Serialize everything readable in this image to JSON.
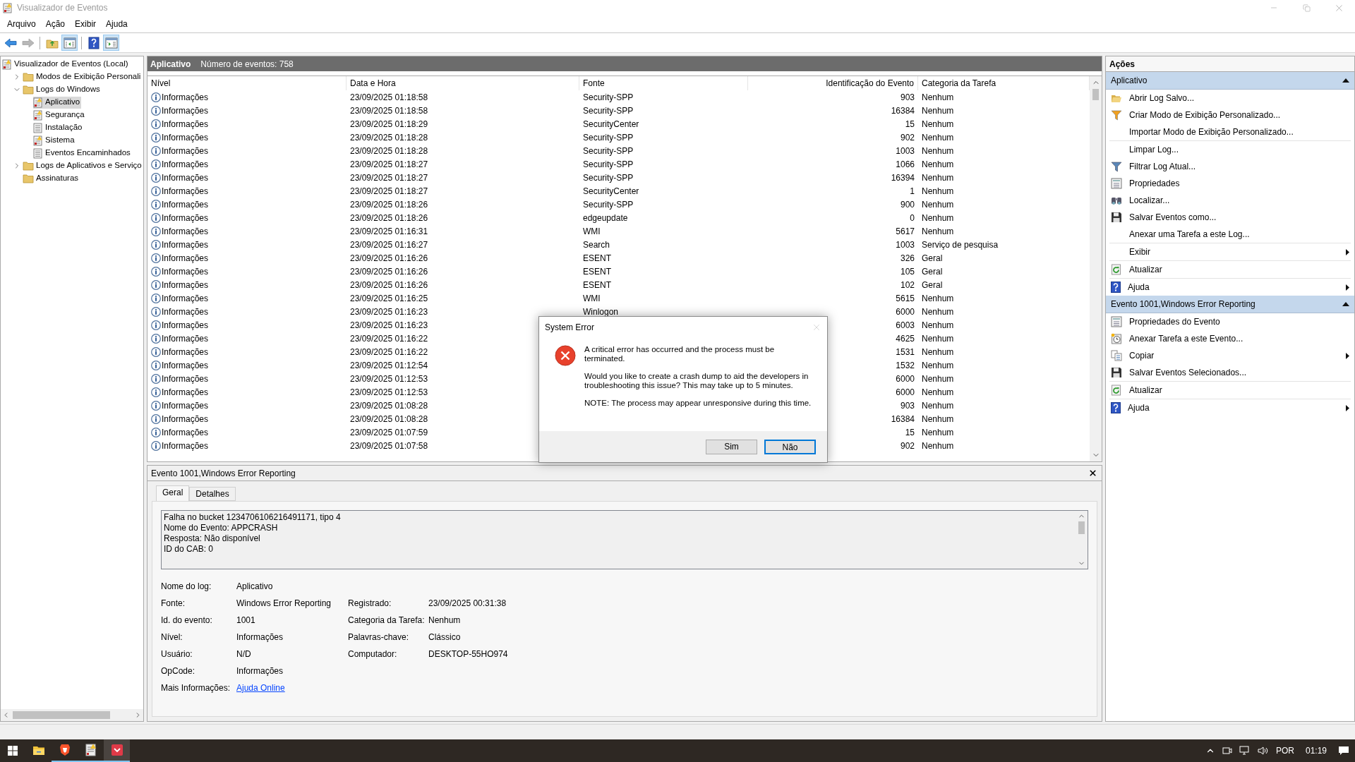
{
  "window": {
    "title": "Visualizador de Eventos"
  },
  "menu": [
    "Arquivo",
    "Ação",
    "Exibir",
    "Ajuda"
  ],
  "toolbar": [
    {
      "kind": "back",
      "pressed": false,
      "disabled": false
    },
    {
      "kind": "forward",
      "pressed": false,
      "disabled": true
    },
    {
      "kind": "up",
      "pressed": false,
      "disabled": false
    },
    {
      "kind": "tree-pane",
      "pressed": true,
      "disabled": false
    },
    {
      "kind": "help",
      "pressed": false,
      "disabled": false
    },
    {
      "kind": "action-pane",
      "pressed": true,
      "disabled": false
    }
  ],
  "tree": [
    {
      "label": "Visualizador de Eventos (Local)",
      "kind": "viewer",
      "selected": false,
      "children": [
        {
          "label": "Modos de Exibição Personali",
          "kind": "folder",
          "selected": false,
          "expanded": false
        },
        {
          "label": "Logs do Windows",
          "kind": "folder",
          "selected": false,
          "expanded": true,
          "children": [
            {
              "label": "Aplicativo",
              "kind": "log-alert",
              "selected": true
            },
            {
              "label": "Segurança",
              "kind": "log-alert",
              "selected": false
            },
            {
              "label": "Instalação",
              "kind": "log",
              "selected": false
            },
            {
              "label": "Sistema",
              "kind": "log-alert",
              "selected": false
            },
            {
              "label": "Eventos Encaminhados",
              "kind": "log",
              "selected": false
            }
          ]
        },
        {
          "label": "Logs de Aplicativos e Serviço",
          "kind": "folder",
          "selected": false,
          "expanded": false
        },
        {
          "label": "Assinaturas",
          "kind": "folder",
          "selected": false
        }
      ]
    }
  ],
  "log_header": {
    "title": "Aplicativo",
    "count": "Número de eventos: 758"
  },
  "table": {
    "columns": [
      "Nível",
      "Data e Hora",
      "Fonte",
      "Identificação do Evento",
      "Categoria da Tarefa"
    ],
    "rows": [
      {
        "level": "Informações",
        "date": "23/09/2025 01:18:58",
        "source": "Security-SPP",
        "id": "903",
        "category": "Nenhum"
      },
      {
        "level": "Informações",
        "date": "23/09/2025 01:18:58",
        "source": "Security-SPP",
        "id": "16384",
        "category": "Nenhum"
      },
      {
        "level": "Informações",
        "date": "23/09/2025 01:18:29",
        "source": "SecurityCenter",
        "id": "15",
        "category": "Nenhum"
      },
      {
        "level": "Informações",
        "date": "23/09/2025 01:18:28",
        "source": "Security-SPP",
        "id": "902",
        "category": "Nenhum"
      },
      {
        "level": "Informações",
        "date": "23/09/2025 01:18:28",
        "source": "Security-SPP",
        "id": "1003",
        "category": "Nenhum"
      },
      {
        "level": "Informações",
        "date": "23/09/2025 01:18:27",
        "source": "Security-SPP",
        "id": "1066",
        "category": "Nenhum"
      },
      {
        "level": "Informações",
        "date": "23/09/2025 01:18:27",
        "source": "Security-SPP",
        "id": "16394",
        "category": "Nenhum"
      },
      {
        "level": "Informações",
        "date": "23/09/2025 01:18:27",
        "source": "SecurityCenter",
        "id": "1",
        "category": "Nenhum"
      },
      {
        "level": "Informações",
        "date": "23/09/2025 01:18:26",
        "source": "Security-SPP",
        "id": "900",
        "category": "Nenhum"
      },
      {
        "level": "Informações",
        "date": "23/09/2025 01:18:26",
        "source": "edgeupdate",
        "id": "0",
        "category": "Nenhum"
      },
      {
        "level": "Informações",
        "date": "23/09/2025 01:16:31",
        "source": "WMI",
        "id": "5617",
        "category": "Nenhum"
      },
      {
        "level": "Informações",
        "date": "23/09/2025 01:16:27",
        "source": "Search",
        "id": "1003",
        "category": "Serviço de pesquisa"
      },
      {
        "level": "Informações",
        "date": "23/09/2025 01:16:26",
        "source": "ESENT",
        "id": "326",
        "category": "Geral"
      },
      {
        "level": "Informações",
        "date": "23/09/2025 01:16:26",
        "source": "ESENT",
        "id": "105",
        "category": "Geral"
      },
      {
        "level": "Informações",
        "date": "23/09/2025 01:16:26",
        "source": "ESENT",
        "id": "102",
        "category": "Geral"
      },
      {
        "level": "Informações",
        "date": "23/09/2025 01:16:25",
        "source": "WMI",
        "id": "5615",
        "category": "Nenhum"
      },
      {
        "level": "Informações",
        "date": "23/09/2025 01:16:23",
        "source": "Winlogon",
        "id": "6000",
        "category": "Nenhum"
      },
      {
        "level": "Informações",
        "date": "23/09/2025 01:16:23",
        "id": "6003",
        "category": "Nenhum"
      },
      {
        "level": "Informações",
        "date": "23/09/2025 01:16:22",
        "id": "4625",
        "category": "Nenhum"
      },
      {
        "level": "Informações",
        "date": "23/09/2025 01:16:22",
        "id": "1531",
        "category": "Nenhum"
      },
      {
        "level": "Informações",
        "date": "23/09/2025 01:12:54",
        "id": "1532",
        "category": "Nenhum"
      },
      {
        "level": "Informações",
        "date": "23/09/2025 01:12:53",
        "id": "6000",
        "category": "Nenhum"
      },
      {
        "level": "Informações",
        "date": "23/09/2025 01:12:53",
        "id": "6000",
        "category": "Nenhum"
      },
      {
        "level": "Informações",
        "date": "23/09/2025 01:08:28",
        "id": "903",
        "category": "Nenhum"
      },
      {
        "level": "Informações",
        "date": "23/09/2025 01:08:28",
        "id": "16384",
        "category": "Nenhum"
      },
      {
        "level": "Informações",
        "date": "23/09/2025 01:07:59",
        "id": "15",
        "category": "Nenhum"
      },
      {
        "level": "Informações",
        "date": "23/09/2025 01:07:58",
        "id": "902",
        "category": "Nenhum"
      }
    ]
  },
  "detail": {
    "title": "Evento 1001,Windows Error Reporting",
    "tabs": [
      {
        "label": "Geral",
        "selected": true
      },
      {
        "label": "Detalhes",
        "selected": false
      }
    ],
    "description": [
      "Falha no bucket 1234706106216491171, tipo 4",
      "Nome do Evento: APPCRASH",
      "Resposta: Não disponível",
      "ID do CAB: 0"
    ],
    "fields": [
      {
        "label": "Nome do log:",
        "value": "Aplicativo"
      },
      {
        "label": "Fonte:",
        "value": "Windows Error Reporting",
        "label2": "Registrado:",
        "value2": "23/09/2025 00:31:38"
      },
      {
        "label": "Id. do evento:",
        "value": "1001",
        "label2": "Categoria da Tarefa:",
        "value2": "Nenhum"
      },
      {
        "label": "Nível:",
        "value": "Informações",
        "label2": "Palavras-chave:",
        "value2": "Clássico"
      },
      {
        "label": "Usuário:",
        "value": "N/D",
        "label2": "Computador:",
        "value2": "DESKTOP-55HO974"
      },
      {
        "label": "OpCode:",
        "value": "Informações"
      },
      {
        "label": "Mais Informações:",
        "value": "Ajuda Online",
        "kind": "link"
      }
    ]
  },
  "actions": {
    "title": "Ações",
    "sections": [
      {
        "title": "Aplicativo",
        "expanded": true,
        "groups": [
          [
            {
              "label": "Abrir Log Salvo...",
              "kind": "open",
              "submenu": false
            },
            {
              "label": "Criar Modo de Exibição Personalizado...",
              "kind": "filter-new",
              "submenu": false
            },
            {
              "label": "Importar Modo de Exibição Personalizado...",
              "submenu": false
            }
          ],
          [
            {
              "label": "Limpar Log...",
              "submenu": false
            },
            {
              "label": "Filtrar Log Atual...",
              "kind": "filter",
              "submenu": false
            },
            {
              "label": "Propriedades",
              "kind": "properties",
              "submenu": false
            },
            {
              "label": "Localizar...",
              "kind": "find",
              "submenu": false
            },
            {
              "label": "Salvar Eventos como...",
              "kind": "save",
              "submenu": false
            },
            {
              "label": "Anexar uma Tarefa a este Log...",
              "submenu": false
            }
          ],
          [
            {
              "label": "Exibir",
              "submenu": true
            }
          ],
          [
            {
              "label": "Atualizar",
              "kind": "refresh",
              "submenu": false
            }
          ],
          [
            {
              "label": "Ajuda",
              "kind": "help",
              "submenu": true
            }
          ]
        ]
      },
      {
        "title": "Evento 1001,Windows Error Reporting",
        "expanded": true,
        "groups": [
          [
            {
              "label": "Propriedades do Evento",
              "kind": "properties",
              "submenu": false
            },
            {
              "label": "Anexar Tarefa a este Evento...",
              "kind": "attach",
              "submenu": false
            },
            {
              "label": "Copiar",
              "kind": "copy",
              "submenu": true
            },
            {
              "label": "Salvar Eventos Selecionados...",
              "kind": "save",
              "submenu": false
            }
          ],
          [
            {
              "label": "Atualizar",
              "kind": "refresh",
              "submenu": false
            }
          ],
          [
            {
              "label": "Ajuda",
              "kind": "help",
              "submenu": true
            }
          ]
        ]
      }
    ]
  },
  "dialog": {
    "title": "System Error",
    "paragraphs": [
      "A critical error has occurred and the process must be terminated.",
      "Would you like to create a crash dump to aid the developers in troubleshooting this issue? This may take up to 5 minutes.",
      "NOTE: The process may appear unresponsive during this time."
    ],
    "buttons": [
      {
        "label": "Sim",
        "focused": false
      },
      {
        "label": "Não",
        "focused": true
      }
    ]
  },
  "taskbar": {
    "apps": [
      {
        "kind": "explorer",
        "running": false,
        "selected": false
      },
      {
        "kind": "browser",
        "running": true,
        "selected": false
      },
      {
        "kind": "viewer",
        "running": true,
        "selected": false
      },
      {
        "kind": "app",
        "running": true,
        "selected": true
      }
    ],
    "language": "POR",
    "time": "01:19"
  }
}
